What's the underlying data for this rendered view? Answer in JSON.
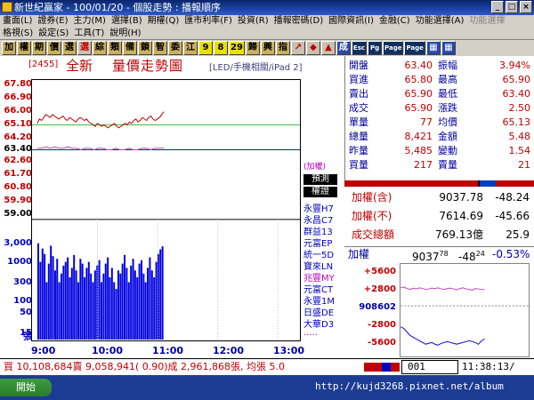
{
  "window": {
    "title": "新世紀贏家 - 100/01/20 - 個股走勢 : 播報順序"
  },
  "menus": [
    {
      "label": "畫面(L)",
      "enabled": true
    },
    {
      "label": "證券(E)",
      "enabled": true
    },
    {
      "label": "主力(M)",
      "enabled": true
    },
    {
      "label": "選擇(B)",
      "enabled": true
    },
    {
      "label": "期權(Q)",
      "enabled": true
    },
    {
      "label": "匯市利率(F)",
      "enabled": true
    },
    {
      "label": "投資(R)",
      "enabled": true
    },
    {
      "label": "播報密碼(D)",
      "enabled": true
    },
    {
      "label": "國際資訊(I)",
      "enabled": true
    },
    {
      "label": "金融(C)",
      "enabled": true
    },
    {
      "label": "功能選擇(A)",
      "enabled": true
    },
    {
      "label": "功能選擇",
      "enabled": false
    }
  ],
  "menus2": [
    "格視(S)",
    "設定(S)",
    "工具(T)",
    "說明(H)"
  ],
  "toolbar": [
    {
      "label": "加",
      "style": ""
    },
    {
      "label": "權",
      "style": ""
    },
    {
      "label": "期",
      "style": ""
    },
    {
      "label": "價",
      "style": ""
    },
    {
      "label": "選",
      "style": ""
    },
    {
      "label": "選",
      "style": "red"
    },
    {
      "label": "綜",
      "style": ""
    },
    {
      "label": "類",
      "style": ""
    },
    {
      "label": "備",
      "style": ""
    },
    {
      "label": "鎖",
      "style": ""
    },
    {
      "label": "智",
      "style": ""
    },
    {
      "label": "委",
      "style": ""
    },
    {
      "label": "江",
      "style": ""
    },
    {
      "label": "9",
      "style": "num"
    },
    {
      "label": "8",
      "style": "num"
    },
    {
      "label": "29",
      "style": "num"
    },
    {
      "label": "歸",
      "style": ""
    },
    {
      "label": "興",
      "style": ""
    },
    {
      "label": "指",
      "style": ""
    },
    {
      "label": "↗",
      "style": "red"
    },
    {
      "label": "◆",
      "style": "red"
    },
    {
      "label": "▲",
      "style": "red"
    },
    {
      "label": "成",
      "style": "blue"
    },
    {
      "label": "Esc",
      "style": "dark"
    },
    {
      "label": "Pg",
      "style": "dark"
    },
    {
      "label": "Page",
      "style": "dark"
    },
    {
      "label": "Page",
      "style": "dark"
    },
    {
      "label": "▦",
      "style": "blue"
    },
    {
      "label": "▦",
      "style": "blue"
    }
  ],
  "header": {
    "code": "[2455]",
    "name": "全新",
    "title": "量價走勢圖",
    "watermark": "[LED/手機相關/iPad 2]"
  },
  "side": {
    "tag1": "(加權)",
    "tag2": "預測",
    "tag3": "權證",
    "warrants": [
      {
        "label": "永豐H7",
        "color": "#0000c0"
      },
      {
        "label": "永昌C7",
        "color": "#0000c0"
      },
      {
        "label": "群益13",
        "color": "#0000c0"
      },
      {
        "label": "元富EP",
        "color": "#0000c0"
      },
      {
        "label": "統一5D",
        "color": "#0000c0"
      },
      {
        "label": "寶來LN",
        "color": "#0000c0"
      },
      {
        "label": "兆豐MY",
        "color": "#c000c0"
      },
      {
        "label": "元富CT",
        "color": "#0000c0"
      },
      {
        "label": "永豐1M",
        "color": "#0000c0"
      },
      {
        "label": "日盛DE",
        "color": "#0000c0"
      },
      {
        "label": "大華D3",
        "color": "#0000c0"
      },
      {
        "label": ".....",
        "color": "#c000c0"
      }
    ]
  },
  "chart_data": {
    "type": "line",
    "price_ticks": [
      {
        "label": "67.80",
        "value": 67.8,
        "color": "#c00000"
      },
      {
        "label": "66.90",
        "value": 66.9,
        "color": "#c00000"
      },
      {
        "label": "66.00",
        "value": 66.0,
        "color": "#c00000"
      },
      {
        "label": "65.10",
        "value": 65.1,
        "color": "#c00000"
      },
      {
        "label": "64.20",
        "value": 64.2,
        "color": "#c00000"
      },
      {
        "label": "63.40",
        "value": 63.4,
        "color": "#000000"
      },
      {
        "label": "62.60",
        "value": 62.6,
        "color": "#c00000"
      },
      {
        "label": "61.70",
        "value": 61.7,
        "color": "#c00000"
      },
      {
        "label": "60.80",
        "value": 60.8,
        "color": "#c00000"
      },
      {
        "label": "59.90",
        "value": 59.9,
        "color": "#c00000"
      },
      {
        "label": "59.00",
        "value": 59.0,
        "color": "#000000"
      }
    ],
    "price_range": [
      59.0,
      67.8
    ],
    "reference_price": 63.4,
    "volume_ticks": [
      {
        "label": "3,000",
        "value": 3000
      },
      {
        "label": "1000",
        "value": 1000
      },
      {
        "label": "300",
        "value": 300
      },
      {
        "label": "100",
        "value": 100
      },
      {
        "label": "50",
        "value": 50
      },
      {
        "label": "15",
        "value": 15
      }
    ],
    "volume_unit": "張",
    "x_ticks": [
      "9:00",
      "10:00",
      "11:00",
      "12:00",
      "13:00"
    ],
    "price_series": [
      65.2,
      65.5,
      65.4,
      65.6,
      65.8,
      65.7,
      65.6,
      65.8,
      65.7,
      65.6,
      65.5,
      65.6,
      65.7,
      65.5,
      65.4,
      65.6,
      65.5,
      65.4,
      65.3,
      65.5,
      65.6,
      65.5,
      65.4,
      65.5,
      65.3,
      65.2,
      65.1,
      65.0,
      65.2,
      65.1,
      65.0,
      65.1,
      65.0,
      64.9,
      65.0,
      65.1,
      65.2,
      65.0,
      64.9,
      65.0,
      65.1,
      65.2,
      65.1,
      65.3,
      65.2,
      65.4,
      65.5,
      65.3,
      65.4,
      65.6,
      65.5,
      65.4,
      65.6,
      65.7,
      65.5,
      65.4,
      65.5,
      65.6,
      65.8,
      66.0
    ],
    "index_series": [
      63.5,
      63.5,
      63.6,
      63.5,
      63.6,
      63.5,
      63.5,
      63.6,
      63.5,
      63.5,
      63.4,
      63.5,
      63.5,
      63.4,
      63.5,
      63.5,
      63.4,
      63.4,
      63.5,
      63.4,
      63.4,
      63.5,
      63.4,
      63.4,
      63.5,
      63.5,
      63.4,
      63.5,
      63.5,
      63.5
    ],
    "volume_series": [
      3000,
      1000,
      2200,
      1600,
      300,
      900,
      2600,
      1400,
      600,
      1200,
      300,
      500,
      800,
      1000,
      1300,
      400,
      700,
      1500,
      600,
      300,
      1200,
      900,
      400,
      700,
      1000,
      500,
      300,
      600,
      800,
      1100,
      300,
      500,
      900,
      1300,
      400,
      700,
      300,
      200,
      600,
      500,
      900,
      1500,
      700,
      300,
      800,
      1200,
      600,
      400,
      900,
      1100,
      500,
      300,
      700,
      1300,
      600,
      400,
      1000,
      1600,
      2100,
      2500
    ]
  },
  "stats": {
    "rows": [
      {
        "k1": "開盤",
        "v1": "63.40",
        "c1": "#c00000",
        "k2": "振幅",
        "v2": "3.94%",
        "c2": "#c00000"
      },
      {
        "k1": "買進",
        "v1": "65.80",
        "c1": "#c00000",
        "k2": "最高",
        "v2": "65.90",
        "c2": "#c00000"
      },
      {
        "k1": "賣出",
        "v1": "65.90",
        "c1": "#c00000",
        "k2": "最低",
        "v2": "63.40",
        "c2": "#c00000"
      },
      {
        "k1": "成交",
        "v1": "65.90",
        "c1": "#c00000",
        "k2": "漲跌",
        "v2": "2.50",
        "c2": "#c00000"
      },
      {
        "k1": "單量",
        "v1": "77",
        "c1": "#c00000",
        "k2": "均價",
        "v2": "65.13",
        "c2": "#c00000"
      },
      {
        "k1": "總量",
        "v1": "8,421",
        "c1": "#c00000",
        "k2": "金額",
        "v2": "5.48",
        "c2": "#c00000"
      },
      {
        "k1": "昨量",
        "v1": "5,485",
        "c1": "#c00000",
        "k2": "變動",
        "v2": "1.54",
        "c2": "#c00000"
      },
      {
        "k1": "買量",
        "v1": "217",
        "c1": "#c00000",
        "k2": "賣量",
        "v2": "21",
        "c2": "#c00000"
      }
    ]
  },
  "colorbar": [
    {
      "color": "#c00000",
      "width": 150
    },
    {
      "color": "#000000",
      "width": 2
    },
    {
      "color": "#0040c0",
      "width": 18
    },
    {
      "color": "#c00000",
      "width": 43
    }
  ],
  "index": {
    "rows": [
      {
        "k": "加權(含)",
        "v": "9037.78",
        "c": "-48.24"
      },
      {
        "k": "加權(不)",
        "v": "7614.69",
        "c": "-45.66"
      },
      {
        "k": "成交總額",
        "v": "769.13億",
        "c": "25.9"
      }
    ]
  },
  "mini": {
    "label": "加權",
    "value": "9037",
    "value_frac": "78",
    "change": "-48",
    "change_frac": "24",
    "pct": "-0.53%",
    "ticks": [
      {
        "label": "+5600",
        "color": "#c00000"
      },
      {
        "label": "+2800",
        "color": "#c00000"
      },
      {
        "label": "908602",
        "color": "#0000a0"
      },
      {
        "label": "-2800",
        "color": "#c00000"
      },
      {
        "label": "-5600",
        "color": "#c00000"
      }
    ],
    "up_series": [
      60,
      58,
      62,
      64,
      61,
      63,
      60,
      62,
      64,
      63,
      61,
      62,
      60,
      63,
      64,
      62,
      61,
      63,
      65,
      62,
      60,
      63,
      64,
      66,
      62,
      63,
      64,
      65
    ],
    "down_series": [
      72,
      74,
      78,
      82,
      84,
      86,
      88,
      90,
      92,
      91,
      90,
      92,
      93,
      91,
      90,
      89,
      90,
      91,
      92,
      91,
      90,
      89,
      88,
      89,
      90,
      92,
      88,
      86
    ]
  },
  "status": {
    "ticker": "買 10,108,684賣 9,058,941( 0.90)成 2,961,868張, 均張 5.0",
    "squares": [
      "#c00000",
      "#c00000",
      "#0000c0",
      "#c00000"
    ],
    "counter": "001",
    "clock": "11:38:13/"
  },
  "taskbar": {
    "start": "開始",
    "site": "http://kujd3268.pixnet.net/album"
  }
}
